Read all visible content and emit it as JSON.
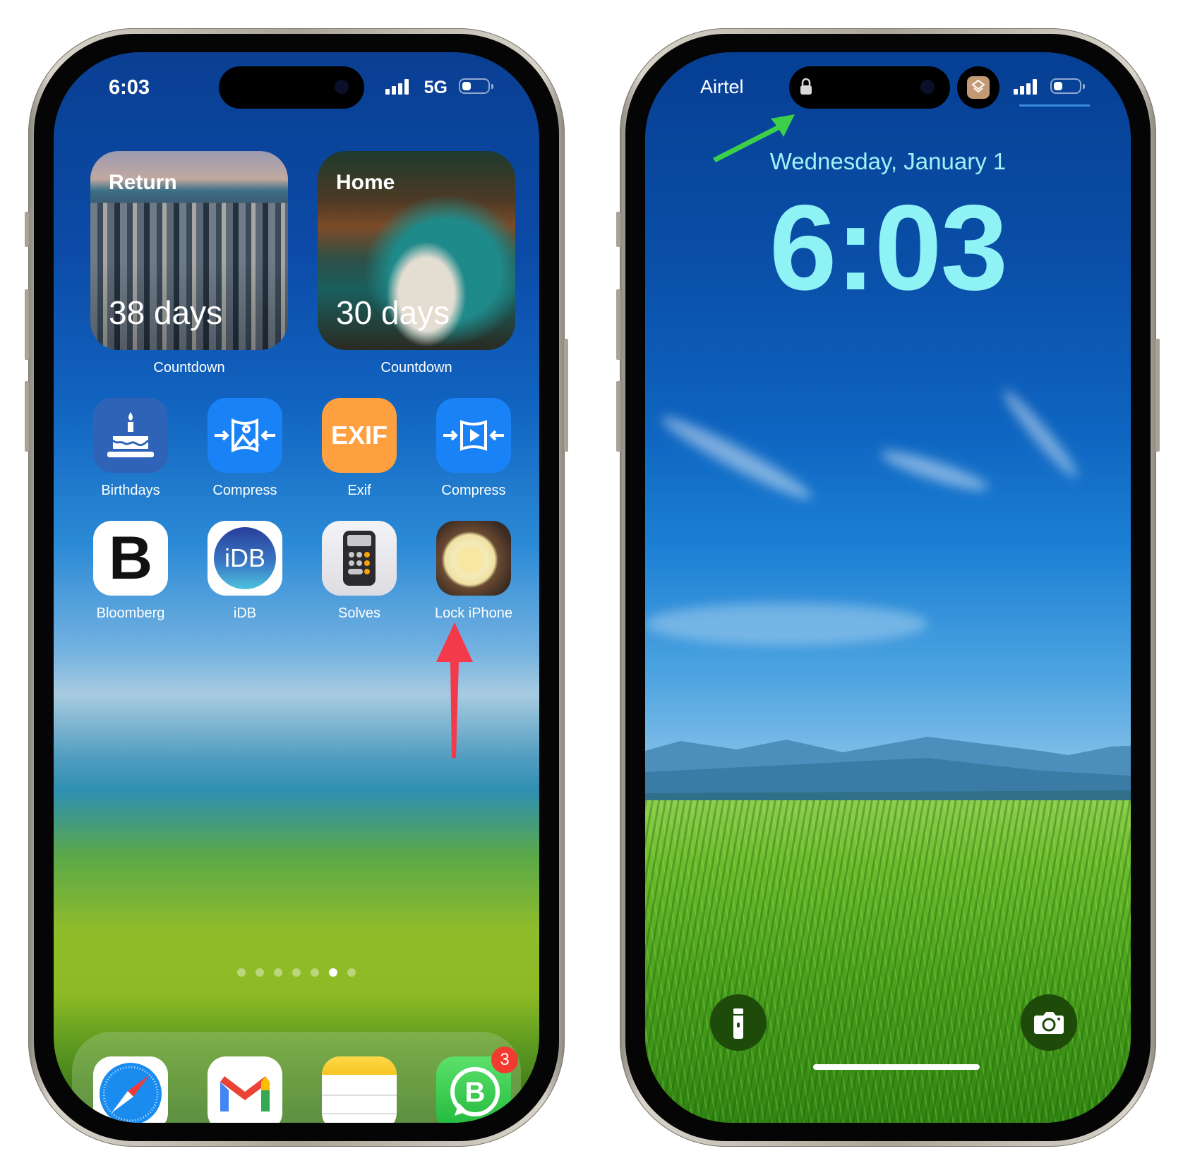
{
  "home_screen": {
    "status_bar": {
      "time": "6:03",
      "network": "5G",
      "signal_icon": "cellular-signal-icon",
      "battery_icon": "battery-low-power-icon"
    },
    "widgets": [
      {
        "title": "Return",
        "value": "38 days",
        "label": "Countdown"
      },
      {
        "title": "Home",
        "value": "30 days",
        "label": "Countdown"
      }
    ],
    "apps": [
      {
        "label": "Birthdays",
        "icon": "birthday-cake-icon",
        "color": "#2e63b8"
      },
      {
        "label": "Compress",
        "icon": "compress-image-icon",
        "color": "#1a82f7"
      },
      {
        "label": "Exif",
        "icon": "exif-icon",
        "icon_text": "EXIF",
        "color": "#ffa040"
      },
      {
        "label": "Compress",
        "icon": "compress-video-icon",
        "color": "#1a82f7"
      },
      {
        "label": "Bloomberg",
        "icon": "bloomberg-icon",
        "icon_text": "B",
        "color": "#ffffff"
      },
      {
        "label": "iDB",
        "icon": "idb-icon",
        "icon_text": "iDB",
        "color": "#ffffff"
      },
      {
        "label": "Solves",
        "icon": "calculator-icon",
        "color": "#eeeef2"
      },
      {
        "label": "Lock iPhone",
        "icon": "flower-photo-icon",
        "color": "#f5e9a8"
      }
    ],
    "page_dots": {
      "count": 7,
      "active_index": 5
    },
    "dock": [
      {
        "name": "Safari",
        "icon": "safari-compass-icon"
      },
      {
        "name": "Gmail",
        "icon": "gmail-icon"
      },
      {
        "name": "Notes",
        "icon": "notes-icon"
      },
      {
        "name": "WhatsApp Business",
        "icon": "whatsapp-business-icon",
        "badge": "3"
      }
    ],
    "annotation": {
      "type": "arrow",
      "color": "#f23a4a",
      "points_to": "Lock iPhone"
    }
  },
  "lock_screen": {
    "status_bar": {
      "carrier": "Airtel",
      "lock_icon": "padlock-icon",
      "live_activity_icon": "shortcuts-icon",
      "live_activity_color": "#c49a74"
    },
    "date": "Wednesday, January 1",
    "time": "6:03",
    "clock_color": "#8ff3f6",
    "buttons": [
      {
        "name": "Flashlight",
        "icon": "flashlight-icon"
      },
      {
        "name": "Camera",
        "icon": "camera-icon"
      }
    ],
    "annotation": {
      "type": "arrow",
      "color": "#3ccf4a",
      "points_to": "padlock-icon"
    }
  }
}
